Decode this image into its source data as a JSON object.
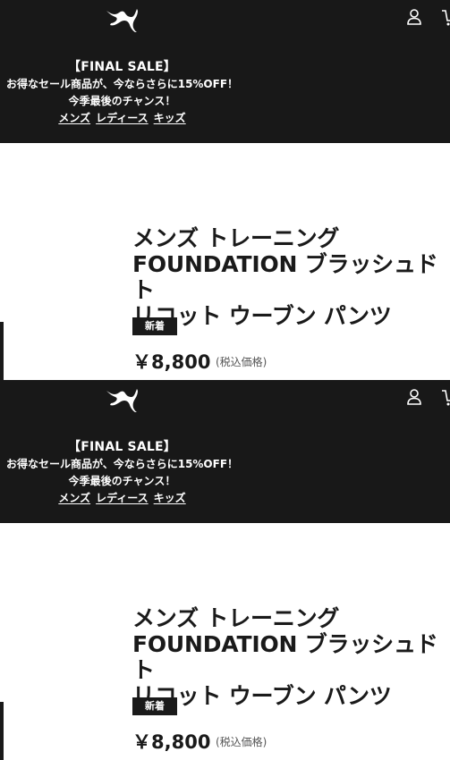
{
  "header": {
    "logo_icon": "puma-logo-icon",
    "account_icon": "user-icon",
    "cart_icon": "cart-icon"
  },
  "promo": {
    "title": "【FINAL SALE】",
    "line1": "お得なセール商品が、今ならさらに15%OFF！",
    "line2": "今季最後のチャンス！",
    "links": [
      "メンズ",
      "レディース",
      "キッズ"
    ]
  },
  "product": {
    "name": "メンズ トレーニング\nFOUNDATION ブラッシュド ト\nリコット ウーブン パンツ",
    "badge": "新着",
    "price": "￥8,800",
    "tax_note": "(税込価格)"
  },
  "colors": {
    "header_bg": "#181818",
    "text": "#1a1a1a",
    "white": "#ffffff"
  }
}
